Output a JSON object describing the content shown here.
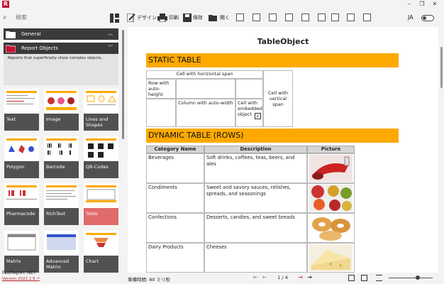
{
  "app": {
    "logo_letter": "R",
    "lang": "JA"
  },
  "search": {
    "placeholder": "検索"
  },
  "toolbar": {
    "design_label": "デザイン",
    "print_label": "印刷",
    "save_label": "保存",
    "open_label": "開く"
  },
  "sidebar": {
    "categories": [
      {
        "label": "General"
      },
      {
        "label": "Report Objects"
      }
    ],
    "description": "Reports that superficially show complex objects.",
    "tiles": [
      {
        "label": "Text"
      },
      {
        "label": "Image"
      },
      {
        "label": "Lines and Shapes"
      },
      {
        "label": "Polygon"
      },
      {
        "label": "Barcode"
      },
      {
        "label": "QR-Codes"
      },
      {
        "label": "Pharmacode"
      },
      {
        "label": "RichText"
      },
      {
        "label": "Table"
      },
      {
        "label": "Matrix"
      },
      {
        "label": "Advanced Matrix"
      },
      {
        "label": "Chart"
      }
    ]
  },
  "brand": {
    "name": "FastReport .NET",
    "version": "Version 2022.2.9"
  },
  "status": {
    "text": "準備時間: 80 ミリ秒"
  },
  "pager": {
    "page_label": "1 / 4"
  },
  "report": {
    "title": "TableObject",
    "static_header": "STATIC TABLE",
    "static": {
      "hspan": "Cell with horizontal span",
      "autoheight": "Row with auto-height",
      "autowidth": "Column with auto-width",
      "embedded": "Cell with embedded object",
      "vspan": "Cell with vertical span"
    },
    "dynamic_header": "DYNAMIC TABLE (ROWS)",
    "columns": [
      "Category Name",
      "Description",
      "Picture"
    ],
    "rows": [
      {
        "name": "Beverages",
        "desc": "Soft drinks, coffees, teas, beers, and ales"
      },
      {
        "name": "Condiments",
        "desc": "Sweet and savory sauces, relishes, spreads, and seasonings"
      },
      {
        "name": "Confections",
        "desc": "Desserts, candies, and sweet breads"
      },
      {
        "name": "Dairy Products",
        "desc": "Cheeses"
      }
    ]
  },
  "colors": {
    "band": "#fda900",
    "accent": "#c8102e",
    "dark": "#3a3a3a"
  }
}
